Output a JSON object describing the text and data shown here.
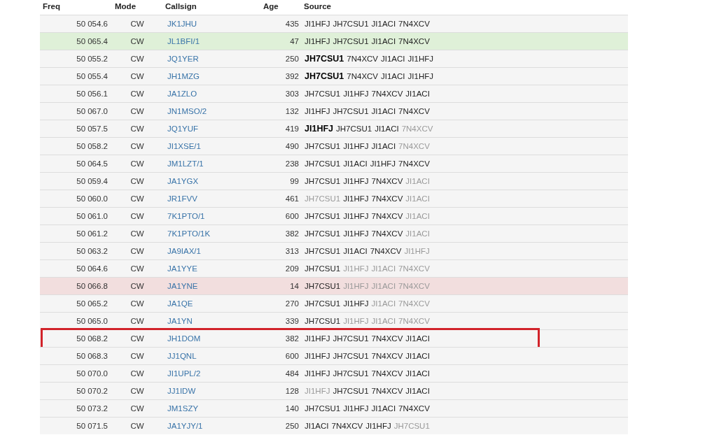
{
  "table": {
    "columns": [
      "Freq",
      "Mode",
      "Callsign",
      "Age",
      "Source"
    ],
    "rows": [
      {
        "freq": "50 054.6",
        "mode": "CW",
        "callsign": "JK1JHU",
        "age": "435",
        "color": "#f5f5f5",
        "marked": false,
        "source": [
          {
            "call": "JI1HFJ",
            "bold": false,
            "dimmed": false
          },
          {
            "call": "JH7CSU1",
            "bold": false,
            "dimmed": false
          },
          {
            "call": "JI1ACI",
            "bold": false,
            "dimmed": false
          },
          {
            "call": "7N4XCV",
            "bold": false,
            "dimmed": false
          }
        ]
      },
      {
        "freq": "50 065.4",
        "mode": "CW",
        "callsign": "JL1BFI/1",
        "age": "47",
        "color": "#dff0d8",
        "marked": false,
        "source": [
          {
            "call": "JI1HFJ",
            "bold": false,
            "dimmed": false
          },
          {
            "call": "JH7CSU1",
            "bold": false,
            "dimmed": false
          },
          {
            "call": "JI1ACI",
            "bold": false,
            "dimmed": false
          },
          {
            "call": "7N4XCV",
            "bold": false,
            "dimmed": false
          }
        ]
      },
      {
        "freq": "50 055.2",
        "mode": "CW",
        "callsign": "JQ1YER",
        "age": "250",
        "color": "#f5f5f5",
        "marked": false,
        "source": [
          {
            "call": "JH7CSU1",
            "bold": true,
            "dimmed": false
          },
          {
            "call": "7N4XCV",
            "bold": false,
            "dimmed": false
          },
          {
            "call": "JI1ACI",
            "bold": false,
            "dimmed": false
          },
          {
            "call": "JI1HFJ",
            "bold": false,
            "dimmed": false
          }
        ]
      },
      {
        "freq": "50 055.4",
        "mode": "CW",
        "callsign": "JH1MZG",
        "age": "392",
        "color": "#f5f5f5",
        "marked": false,
        "source": [
          {
            "call": "JH7CSU1",
            "bold": true,
            "dimmed": false
          },
          {
            "call": "7N4XCV",
            "bold": false,
            "dimmed": false
          },
          {
            "call": "JI1ACI",
            "bold": false,
            "dimmed": false
          },
          {
            "call": "JI1HFJ",
            "bold": false,
            "dimmed": false
          }
        ]
      },
      {
        "freq": "50 056.1",
        "mode": "CW",
        "callsign": "JA1ZLO",
        "age": "303",
        "color": "#f5f5f5",
        "marked": false,
        "source": [
          {
            "call": "JH7CSU1",
            "bold": false,
            "dimmed": false
          },
          {
            "call": "JI1HFJ",
            "bold": false,
            "dimmed": false
          },
          {
            "call": "7N4XCV",
            "bold": false,
            "dimmed": false
          },
          {
            "call": "JI1ACI",
            "bold": false,
            "dimmed": false
          }
        ]
      },
      {
        "freq": "50 067.0",
        "mode": "CW",
        "callsign": "JN1MSO/2",
        "age": "132",
        "color": "#f5f5f5",
        "marked": false,
        "source": [
          {
            "call": "JI1HFJ",
            "bold": false,
            "dimmed": false
          },
          {
            "call": "JH7CSU1",
            "bold": false,
            "dimmed": false
          },
          {
            "call": "JI1ACI",
            "bold": false,
            "dimmed": false
          },
          {
            "call": "7N4XCV",
            "bold": false,
            "dimmed": false
          }
        ]
      },
      {
        "freq": "50 057.5",
        "mode": "CW",
        "callsign": "JQ1YUF",
        "age": "419",
        "color": "#f5f5f5",
        "marked": false,
        "source": [
          {
            "call": "JI1HFJ",
            "bold": true,
            "dimmed": false
          },
          {
            "call": "JH7CSU1",
            "bold": false,
            "dimmed": false
          },
          {
            "call": "JI1ACI",
            "bold": false,
            "dimmed": false
          },
          {
            "call": "7N4XCV",
            "bold": false,
            "dimmed": true
          }
        ]
      },
      {
        "freq": "50 058.2",
        "mode": "CW",
        "callsign": "JI1XSE/1",
        "age": "490",
        "color": "#f5f5f5",
        "marked": false,
        "source": [
          {
            "call": "JH7CSU1",
            "bold": false,
            "dimmed": false
          },
          {
            "call": "JI1HFJ",
            "bold": false,
            "dimmed": false
          },
          {
            "call": "JI1ACI",
            "bold": false,
            "dimmed": false
          },
          {
            "call": "7N4XCV",
            "bold": false,
            "dimmed": true
          }
        ]
      },
      {
        "freq": "50 064.5",
        "mode": "CW",
        "callsign": "JM1LZT/1",
        "age": "238",
        "color": "#f5f5f5",
        "marked": false,
        "source": [
          {
            "call": "JH7CSU1",
            "bold": false,
            "dimmed": false
          },
          {
            "call": "JI1ACI",
            "bold": false,
            "dimmed": false
          },
          {
            "call": "JI1HFJ",
            "bold": false,
            "dimmed": false
          },
          {
            "call": "7N4XCV",
            "bold": false,
            "dimmed": false
          }
        ]
      },
      {
        "freq": "50 059.4",
        "mode": "CW",
        "callsign": "JA1YGX",
        "age": "99",
        "color": "#f5f5f5",
        "marked": false,
        "source": [
          {
            "call": "JH7CSU1",
            "bold": false,
            "dimmed": false
          },
          {
            "call": "JI1HFJ",
            "bold": false,
            "dimmed": false
          },
          {
            "call": "7N4XCV",
            "bold": false,
            "dimmed": false
          },
          {
            "call": "JI1ACI",
            "bold": false,
            "dimmed": true
          }
        ]
      },
      {
        "freq": "50 060.0",
        "mode": "CW",
        "callsign": "JR1FVV",
        "age": "461",
        "color": "#f5f5f5",
        "marked": false,
        "source": [
          {
            "call": "JH7CSU1",
            "bold": false,
            "dimmed": true
          },
          {
            "call": "JI1HFJ",
            "bold": false,
            "dimmed": false
          },
          {
            "call": "7N4XCV",
            "bold": false,
            "dimmed": false
          },
          {
            "call": "JI1ACI",
            "bold": false,
            "dimmed": true
          }
        ]
      },
      {
        "freq": "50 061.0",
        "mode": "CW",
        "callsign": "7K1PTO/1",
        "age": "600",
        "color": "#f5f5f5",
        "marked": false,
        "source": [
          {
            "call": "JH7CSU1",
            "bold": false,
            "dimmed": false
          },
          {
            "call": "JI1HFJ",
            "bold": false,
            "dimmed": false
          },
          {
            "call": "7N4XCV",
            "bold": false,
            "dimmed": false
          },
          {
            "call": "JI1ACI",
            "bold": false,
            "dimmed": true
          }
        ]
      },
      {
        "freq": "50 061.2",
        "mode": "CW",
        "callsign": "7K1PTO/1K",
        "age": "382",
        "color": "#f5f5f5",
        "marked": false,
        "source": [
          {
            "call": "JH7CSU1",
            "bold": false,
            "dimmed": false
          },
          {
            "call": "JI1HFJ",
            "bold": false,
            "dimmed": false
          },
          {
            "call": "7N4XCV",
            "bold": false,
            "dimmed": false
          },
          {
            "call": "JI1ACI",
            "bold": false,
            "dimmed": true
          }
        ]
      },
      {
        "freq": "50 063.2",
        "mode": "CW",
        "callsign": "JA9IAX/1",
        "age": "313",
        "color": "#f5f5f5",
        "marked": false,
        "source": [
          {
            "call": "JH7CSU1",
            "bold": false,
            "dimmed": false
          },
          {
            "call": "JI1ACI",
            "bold": false,
            "dimmed": false
          },
          {
            "call": "7N4XCV",
            "bold": false,
            "dimmed": false
          },
          {
            "call": "JI1HFJ",
            "bold": false,
            "dimmed": true
          }
        ]
      },
      {
        "freq": "50 064.6",
        "mode": "CW",
        "callsign": "JA1YYE",
        "age": "209",
        "color": "#f5f5f5",
        "marked": false,
        "source": [
          {
            "call": "JH7CSU1",
            "bold": false,
            "dimmed": false
          },
          {
            "call": "JI1HFJ",
            "bold": false,
            "dimmed": true
          },
          {
            "call": "JI1ACI",
            "bold": false,
            "dimmed": true
          },
          {
            "call": "7N4XCV",
            "bold": false,
            "dimmed": true
          }
        ]
      },
      {
        "freq": "50 066.8",
        "mode": "CW",
        "callsign": "JA1YNE",
        "age": "14",
        "color": "#f2dede",
        "marked": false,
        "source": [
          {
            "call": "JH7CSU1",
            "bold": false,
            "dimmed": false
          },
          {
            "call": "JI1HFJ",
            "bold": false,
            "dimmed": true
          },
          {
            "call": "JI1ACI",
            "bold": false,
            "dimmed": true
          },
          {
            "call": "7N4XCV",
            "bold": false,
            "dimmed": true
          }
        ]
      },
      {
        "freq": "50 065.2",
        "mode": "CW",
        "callsign": "JA1QE",
        "age": "270",
        "color": "#f5f5f5",
        "marked": false,
        "source": [
          {
            "call": "JH7CSU1",
            "bold": false,
            "dimmed": false
          },
          {
            "call": "JI1HFJ",
            "bold": false,
            "dimmed": false
          },
          {
            "call": "JI1ACI",
            "bold": false,
            "dimmed": true
          },
          {
            "call": "7N4XCV",
            "bold": false,
            "dimmed": true
          }
        ]
      },
      {
        "freq": "50 065.0",
        "mode": "CW",
        "callsign": "JA1YN",
        "age": "339",
        "color": "#f5f5f5",
        "marked": false,
        "source": [
          {
            "call": "JH7CSU1",
            "bold": false,
            "dimmed": false
          },
          {
            "call": "JI1HFJ",
            "bold": false,
            "dimmed": true
          },
          {
            "call": "JI1ACI",
            "bold": false,
            "dimmed": true
          },
          {
            "call": "7N4XCV",
            "bold": false,
            "dimmed": true
          }
        ]
      },
      {
        "freq": "50 068.2",
        "mode": "CW",
        "callsign": "JH1DOM",
        "age": "382",
        "color": "#f5f5f5",
        "marked": true,
        "source": [
          {
            "call": "JI1HFJ",
            "bold": false,
            "dimmed": false
          },
          {
            "call": "JH7CSU1",
            "bold": false,
            "dimmed": false
          },
          {
            "call": "7N4XCV",
            "bold": false,
            "dimmed": false
          },
          {
            "call": "JI1ACI",
            "bold": false,
            "dimmed": false
          }
        ]
      },
      {
        "freq": "50 068.3",
        "mode": "CW",
        "callsign": "JJ1QNL",
        "age": "600",
        "color": "#f5f5f5",
        "marked": false,
        "source": [
          {
            "call": "JI1HFJ",
            "bold": false,
            "dimmed": false
          },
          {
            "call": "JH7CSU1",
            "bold": false,
            "dimmed": false
          },
          {
            "call": "7N4XCV",
            "bold": false,
            "dimmed": false
          },
          {
            "call": "JI1ACI",
            "bold": false,
            "dimmed": false
          }
        ]
      },
      {
        "freq": "50 070.0",
        "mode": "CW",
        "callsign": "JI1UPL/2",
        "age": "484",
        "color": "#f5f5f5",
        "marked": false,
        "source": [
          {
            "call": "JI1HFJ",
            "bold": false,
            "dimmed": false
          },
          {
            "call": "JH7CSU1",
            "bold": false,
            "dimmed": false
          },
          {
            "call": "7N4XCV",
            "bold": false,
            "dimmed": false
          },
          {
            "call": "JI1ACI",
            "bold": false,
            "dimmed": false
          }
        ]
      },
      {
        "freq": "50 070.2",
        "mode": "CW",
        "callsign": "JJ1IDW",
        "age": "128",
        "color": "#f5f5f5",
        "marked": false,
        "source": [
          {
            "call": "JI1HFJ",
            "bold": false,
            "dimmed": true
          },
          {
            "call": "JH7CSU1",
            "bold": false,
            "dimmed": false
          },
          {
            "call": "7N4XCV",
            "bold": false,
            "dimmed": false
          },
          {
            "call": "JI1ACI",
            "bold": false,
            "dimmed": false
          }
        ]
      },
      {
        "freq": "50 073.2",
        "mode": "CW",
        "callsign": "JM1SZY",
        "age": "140",
        "color": "#f5f5f5",
        "marked": false,
        "source": [
          {
            "call": "JH7CSU1",
            "bold": false,
            "dimmed": false
          },
          {
            "call": "JI1HFJ",
            "bold": false,
            "dimmed": false
          },
          {
            "call": "JI1ACI",
            "bold": false,
            "dimmed": false
          },
          {
            "call": "7N4XCV",
            "bold": false,
            "dimmed": false
          }
        ]
      },
      {
        "freq": "50 071.5",
        "mode": "CW",
        "callsign": "JA1YJY/1",
        "age": "250",
        "color": "#f5f5f5",
        "marked": false,
        "source": [
          {
            "call": "JI1ACI",
            "bold": false,
            "dimmed": false
          },
          {
            "call": "7N4XCV",
            "bold": false,
            "dimmed": false
          },
          {
            "call": "JI1HFJ",
            "bold": false,
            "dimmed": false
          },
          {
            "call": "JH7CSU1",
            "bold": false,
            "dimmed": true
          }
        ]
      }
    ]
  }
}
